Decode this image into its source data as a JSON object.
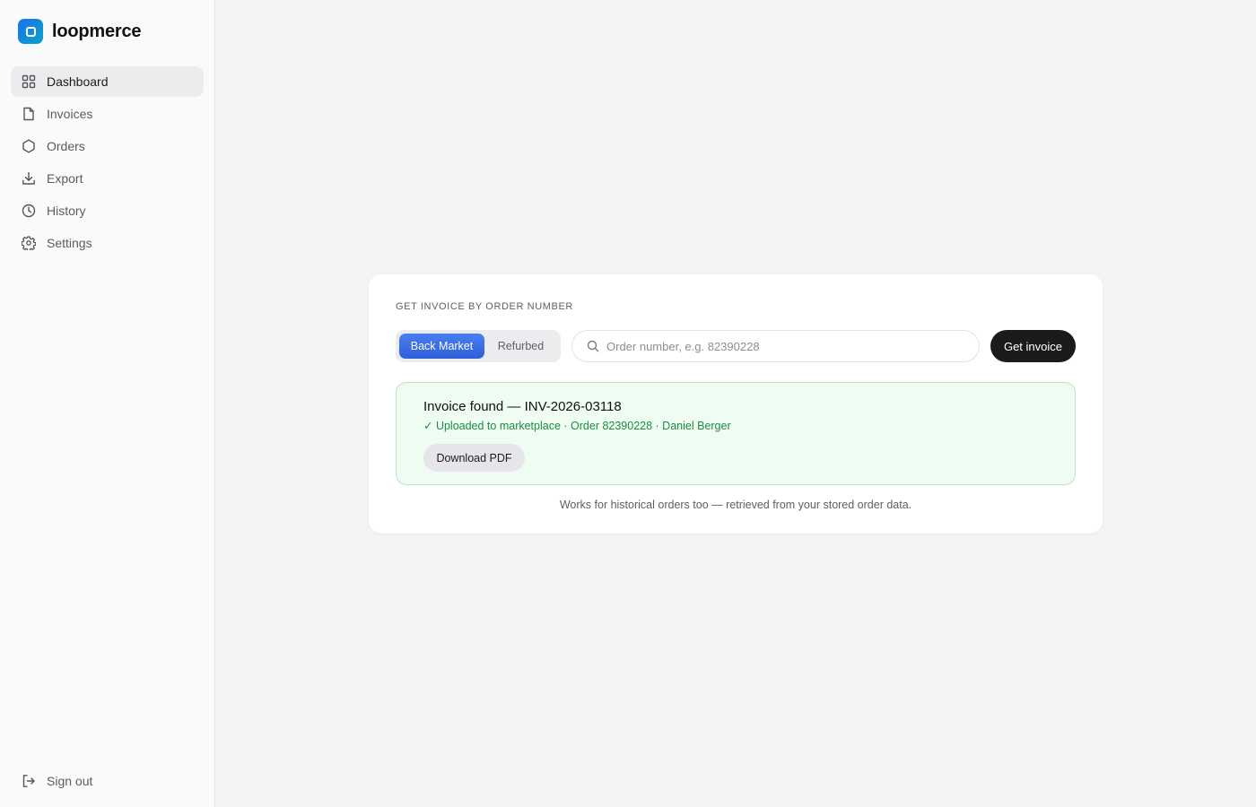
{
  "brand": {
    "name": "loopmerce"
  },
  "sidebar": {
    "items": [
      {
        "label": "Dashboard",
        "icon": "grid-icon",
        "active": true
      },
      {
        "label": "Invoices",
        "icon": "file-icon",
        "active": false
      },
      {
        "label": "Orders",
        "icon": "box-icon",
        "active": false
      },
      {
        "label": "Export",
        "icon": "download-icon",
        "active": false
      },
      {
        "label": "History",
        "icon": "clock-icon",
        "active": false
      },
      {
        "label": "Settings",
        "icon": "gear-icon",
        "active": false
      }
    ],
    "signout": {
      "label": "Sign out",
      "icon": "sign-out-icon"
    }
  },
  "card": {
    "title": "GET INVOICE BY ORDER NUMBER",
    "marketplaces": [
      {
        "label": "Back Market",
        "selected": true
      },
      {
        "label": "Refurbed",
        "selected": false
      }
    ],
    "search": {
      "placeholder": "Order number, e.g. 82390228",
      "value": "",
      "icon": "search-icon"
    },
    "submit_label": "Get invoice",
    "result": {
      "title": "Invoice found — INV-2026-03118",
      "subtitle": "✓ Uploaded to marketplace · Order 82390228 · Daniel Berger",
      "download_label": "Download PDF"
    },
    "footnote": "Works for historical orders too — retrieved from your stored order data."
  },
  "colors": {
    "accent": "#2d5fd9",
    "brand_gradient_start": "#1a73e8",
    "brand_gradient_end": "#0aa3c9",
    "success_text": "#1f8a45",
    "success_bg": "#effcf2",
    "primary_button": "#1b1b1d"
  }
}
